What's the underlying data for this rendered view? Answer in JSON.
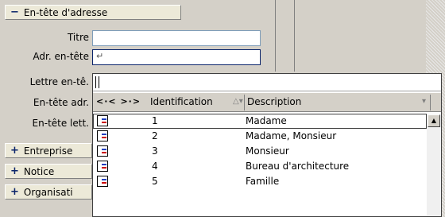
{
  "form": {
    "group_address_header": {
      "sign": "−",
      "label": "En-tête d'adresse"
    },
    "fields": {
      "titre": {
        "label": "Titre",
        "value": ""
      },
      "adr_entete": {
        "label": "Adr. en-tête",
        "value": ""
      },
      "lettre_entete": {
        "label": "Lettre en-tê.",
        "value": ""
      },
      "entete_adr": {
        "label": "En-tête adr."
      },
      "entete_lett": {
        "label": "En-tête lett."
      }
    },
    "groups": [
      {
        "sign": "+",
        "label": "Entreprise"
      },
      {
        "sign": "+",
        "label": "Notice"
      },
      {
        "sign": "+",
        "label": "Organisati"
      }
    ]
  },
  "popup": {
    "filter_value": "",
    "header": {
      "nav_back": "<·<",
      "nav_fwd": ">·>",
      "col_identification": "Identification",
      "col_description": "Description",
      "sort_icon": "sort-icon"
    },
    "rows": [
      {
        "id": "1",
        "description": "Madame",
        "selected": true
      },
      {
        "id": "2",
        "description": "Madame, Monsieur",
        "selected": false
      },
      {
        "id": "3",
        "description": "Monsieur",
        "selected": false
      },
      {
        "id": "4",
        "description": "Bureau d'architecture",
        "selected": false
      },
      {
        "id": "5",
        "description": "Famille",
        "selected": false
      }
    ]
  },
  "colors": {
    "accent": "#0a246a",
    "background": "#d4d0c8",
    "row_icon_red": "#cc0000",
    "row_icon_blue": "#1f3fbf"
  }
}
